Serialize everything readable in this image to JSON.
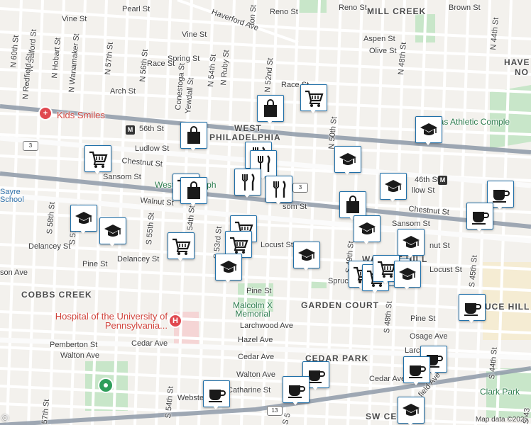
{
  "streets": {
    "vine": "Vine St",
    "vine2": "Vine St",
    "pearl": "Pearl St",
    "haverford": "Haverford Ave",
    "reno": "Reno St",
    "reno2": "Reno St",
    "brown": "Brown St",
    "aspen": "Aspen St",
    "olive": "Olive St",
    "spring": "Spring St",
    "race": "Race St",
    "race2": "Race St",
    "arch": "Arch St",
    "st56": "56th St",
    "ludlow": "Ludlow St",
    "ludlow2": "llow St",
    "chestnut": "Chestnut St",
    "chestnut2": "Chestnut St",
    "sansom": "Sansom St",
    "sansom2": "Sansom St",
    "sansom3": "som St",
    "walnut": "Walnut St",
    "walnut2": "nut St",
    "delancey": "Delancey St",
    "delancey2": "Delancey St",
    "pine": "Pine St",
    "pine2": "Pine St",
    "pine3": "Pine St",
    "locust": "Locust St",
    "locust2": "Locust St",
    "spruce": "Spruc",
    "larchwood": "Larchwood Ave",
    "osage": "Osage Ave",
    "cedar": "Cedar Ave",
    "cedar2": "Cedar Ave",
    "cedar3": "Cedar Ave",
    "hazel": "Hazel Ave",
    "walton": "Walton Ave",
    "walton2": "Walton Ave",
    "pemberton": "Pemberton St",
    "catharine": "Catharine St",
    "webster": "Webste",
    "larc": "Larc",
    "n60": "N 60th St",
    "n_salford": "N Salford St",
    "n_redfield": "N Redfield St",
    "n_hobart": "N Hobart St",
    "n_wanamaker": "N Wanamaker St",
    "n57": "N 57th St",
    "n56": "N 56th St",
    "n54": "N 54th St",
    "n_ruby": "N Ruby St",
    "n_conestoga": "Conestoga St",
    "n_yewdall": "Yewdall St",
    "n52": "N 52nd St",
    "n50": "N 50th St",
    "n48": "N 48th St",
    "n44": "N 44th St",
    "s58": "S 58th St",
    "s57": "S 57th St",
    "s55": "S 55th St",
    "s54": "S 54th St",
    "s53": "S 53rd St",
    "s49": "S 49th St",
    "s48": "S 48th St",
    "s45": "S 45th St",
    "s44": "S 44th St",
    "s43": "S 43",
    "s54b": "S 54th St",
    "s57b": "57th St",
    "s5": "S 5",
    "son_ave": "son Ave",
    "field_ave": "field Ave",
    "ton": "ton St"
  },
  "areas": {
    "mill_creek": "MILL CREEK",
    "west": "WEST",
    "philadelphia": "PHILADELPHIA",
    "cobbs_creek": "COBBS CREEK",
    "garden_court": "GARDEN COURT",
    "cedar_park": "CEDAR PARK",
    "sw_cedar": "SW CEDAR",
    "walnut_hill": "WALNUT HILL",
    "spruce_hill": "UCE HILL",
    "have": "HAVE",
    "no": "NO"
  },
  "places": {
    "kids_smiles": "Kids Smiles",
    "hospital": "Hospital of the University of Pennsylvania...",
    "malcolm_x": "Malcolm X Memorial",
    "sayre": "Sayre School",
    "west_philly": "West Philadelph",
    "athletic": "das Athletic Comple",
    "clark_park": "Clark Park",
    "st_56_label": "56th St",
    "st_46_label": "46th St"
  },
  "shields": {
    "route3a": "3",
    "route3b": "3",
    "route13": "13"
  },
  "attribution": "Map data ©2025",
  "google_mark": "©",
  "colors": {
    "marker_border": "#1f6fa8",
    "icon_fill": "#1a1a1a",
    "rail": "#8e9aa8",
    "park": "#c8e6c9",
    "landmark": "#e0484f"
  },
  "pois": [
    {
      "type": "shopping-cart",
      "icon": "shopping-cart-icon"
    },
    {
      "type": "shopping-bag",
      "icon": "shopping-bag-icon"
    },
    {
      "type": "shopping-bag",
      "icon": "shopping-bag-icon"
    },
    {
      "type": "graduation-cap",
      "icon": "graduation-cap-icon"
    },
    {
      "type": "shopping-cart",
      "icon": "shopping-cart-icon"
    },
    {
      "type": "shopping-bag",
      "icon": "shopping-bag-icon"
    },
    {
      "type": "restaurant",
      "icon": "fork-knife-icon"
    },
    {
      "type": "restaurant",
      "icon": "fork-knife-icon"
    },
    {
      "type": "graduation-cap",
      "icon": "graduation-cap-icon"
    },
    {
      "type": "graduation-cap",
      "icon": "graduation-cap-icon"
    },
    {
      "type": "shopping-cart",
      "icon": "shopping-cart-icon"
    },
    {
      "type": "restaurant",
      "icon": "fork-knife-icon"
    },
    {
      "type": "restaurant",
      "icon": "fork-knife-icon"
    },
    {
      "type": "shopping-cart",
      "icon": "shopping-cart-icon"
    },
    {
      "type": "shopping-bag",
      "icon": "shopping-bag-icon"
    },
    {
      "type": "graduation-cap",
      "icon": "graduation-cap-icon"
    },
    {
      "type": "coffee",
      "icon": "coffee-cup-icon"
    },
    {
      "type": "coffee",
      "icon": "coffee-cup-icon"
    },
    {
      "type": "graduation-cap",
      "icon": "graduation-cap-icon"
    },
    {
      "type": "graduation-cap",
      "icon": "graduation-cap-icon"
    },
    {
      "type": "graduation-cap",
      "icon": "graduation-cap-icon"
    },
    {
      "type": "shopping-cart",
      "icon": "shopping-cart-icon"
    },
    {
      "type": "shopping-cart",
      "icon": "shopping-cart-icon"
    },
    {
      "type": "shopping-cart",
      "icon": "shopping-cart-icon"
    },
    {
      "type": "graduation-cap",
      "icon": "graduation-cap-icon"
    },
    {
      "type": "graduation-cap",
      "icon": "graduation-cap-icon"
    },
    {
      "type": "graduation-cap",
      "icon": "graduation-cap-icon"
    },
    {
      "type": "shopping-cart",
      "icon": "shopping-cart-icon"
    },
    {
      "type": "shopping-cart",
      "icon": "shopping-cart-icon"
    },
    {
      "type": "graduation-cap",
      "icon": "graduation-cap-icon"
    },
    {
      "type": "graduation-cap",
      "icon": "graduation-cap-icon"
    },
    {
      "type": "coffee",
      "icon": "coffee-cup-icon"
    },
    {
      "type": "coffee",
      "icon": "coffee-cup-icon"
    },
    {
      "type": "coffee",
      "icon": "coffee-cup-icon"
    },
    {
      "type": "coffee",
      "icon": "coffee-cup-icon"
    },
    {
      "type": "coffee",
      "icon": "coffee-cup-icon"
    },
    {
      "type": "coffee",
      "icon": "coffee-cup-icon"
    }
  ]
}
